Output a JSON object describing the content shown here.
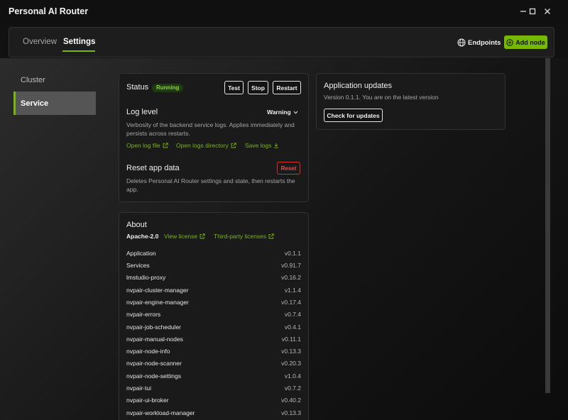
{
  "window": {
    "title": "Personal AI Router",
    "minimize": "—",
    "maximize": "☐",
    "close": "✕"
  },
  "nav": {
    "tabs": [
      {
        "label": "Overview",
        "active": false
      },
      {
        "label": "Settings",
        "active": true
      }
    ],
    "endpoints_label": "Endpoints",
    "add_node_label": "Add node",
    "accent_color": "#76b900"
  },
  "sidebar": {
    "items": [
      {
        "label": "Cluster",
        "active": false
      },
      {
        "label": "Service",
        "active": true
      }
    ]
  },
  "status_card": {
    "title": "Status",
    "status_badge": "Running",
    "buttons": {
      "test": "Test",
      "stop": "Stop",
      "restart": "Restart"
    },
    "log_level": {
      "title": "Log level",
      "value": "Warning",
      "description": "Verbosity of the backend service logs. Applies immediately and persists across restarts."
    },
    "links": {
      "open_log_file": "Open log file",
      "open_logs_directory": "Open logs directory",
      "save_logs": "Save logs"
    },
    "reset": {
      "title": "Reset app data",
      "button": "Reset",
      "description": "Deletes Personal AI Router settings and state, then restarts the app."
    }
  },
  "updates_card": {
    "title": "Application updates",
    "description": "Version 0.1.1. You are on the latest version",
    "button": "Check for updates"
  },
  "about_card": {
    "title": "About",
    "license": "Apache-2.0",
    "view_license": "View license",
    "third_party": "Third-party licenses",
    "versions": [
      {
        "name": "Application",
        "version": "v0.1.1"
      },
      {
        "name": "Services",
        "version": "v0.91.7"
      },
      {
        "name": "lmstudio-proxy",
        "version": "v0.16.2"
      },
      {
        "name": "nvpair-cluster-manager",
        "version": "v1.1.4"
      },
      {
        "name": "nvpair-engine-manager",
        "version": "v0.17.4"
      },
      {
        "name": "nvpair-errors",
        "version": "v0.7.4"
      },
      {
        "name": "nvpair-job-scheduler",
        "version": "v0.4.1"
      },
      {
        "name": "nvpair-manual-nodes",
        "version": "v0.11.1"
      },
      {
        "name": "nvpair-node-info",
        "version": "v0.13.3"
      },
      {
        "name": "nvpair-node-scanner",
        "version": "v0.20.3"
      },
      {
        "name": "nvpair-node-settings",
        "version": "v1.0.4"
      },
      {
        "name": "nvpair-tui",
        "version": "v0.7.2"
      },
      {
        "name": "nvpair-ui-broker",
        "version": "v0.40.2"
      },
      {
        "name": "nvpair-workload-manager",
        "version": "v0.13.3"
      }
    ]
  }
}
